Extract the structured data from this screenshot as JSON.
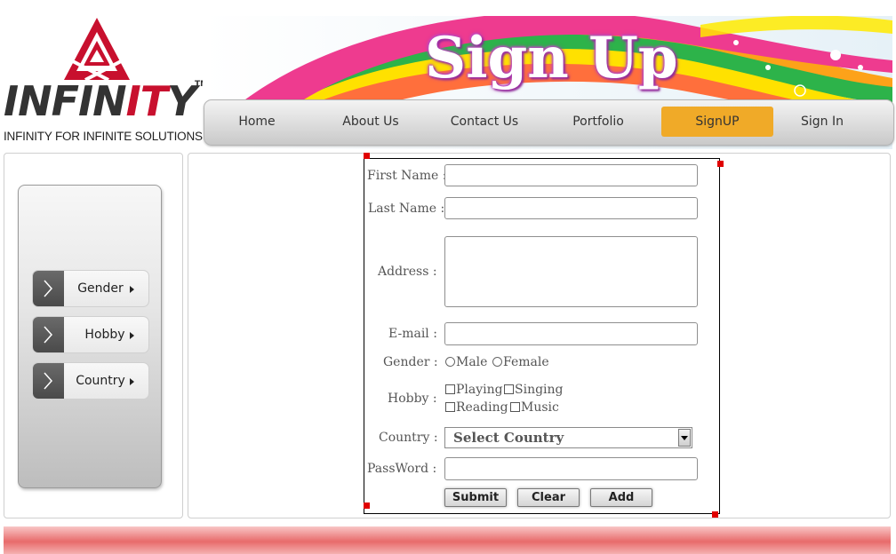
{
  "logo": {
    "word_start": "INFIN",
    "word_red": "IT",
    "word_end": "Y",
    "tm": "TM",
    "tagline": "INFINITY FOR INFINITE SOLUTIONS"
  },
  "banner": {
    "title": "Sign Up"
  },
  "nav": {
    "items": [
      {
        "label": "Home"
      },
      {
        "label": "About Us"
      },
      {
        "label": "Contact Us"
      },
      {
        "label": "Portfolio"
      },
      {
        "label": "SignUP",
        "active": true
      },
      {
        "label": "Sign In"
      }
    ],
    "active_color": "#f0aa28"
  },
  "sidebar": {
    "items": [
      {
        "label": "Gender"
      },
      {
        "label": "Hobby"
      },
      {
        "label": "Country"
      }
    ]
  },
  "form": {
    "first_name": {
      "label": "First Name :",
      "value": ""
    },
    "last_name": {
      "label": "Last Name :",
      "value": ""
    },
    "address": {
      "label": "Address :",
      "value": ""
    },
    "email": {
      "label": "E-mail :",
      "value": ""
    },
    "gender": {
      "label": "Gender :",
      "options": [
        "Male",
        "Female"
      ]
    },
    "hobby": {
      "label": "Hobby :",
      "options": [
        "Playing",
        "Singing",
        "Reading",
        "Music"
      ]
    },
    "country": {
      "label": "Country :",
      "selected": "Select Country"
    },
    "password": {
      "label": "PassWord :",
      "value": ""
    },
    "buttons": {
      "submit": "Submit",
      "clear": "Clear",
      "add": "Add"
    }
  },
  "colors": {
    "brand_red": "#c8102e",
    "footer": "#e86b6b",
    "title_glow": "#b03fb3"
  }
}
